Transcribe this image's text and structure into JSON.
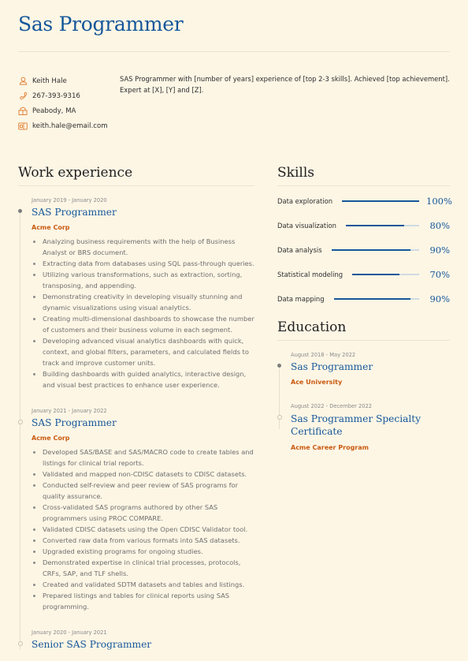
{
  "header": {
    "title": "Sas Programmer"
  },
  "contact": {
    "name": "Keith Hale",
    "phone": "267-393-9316",
    "location": "Peabody, MA",
    "email": "keith.hale@email.com",
    "icons": [
      "user-icon",
      "phone-icon",
      "location-icon",
      "email-icon"
    ],
    "icon_color": "#e0843a"
  },
  "summary": "SAS Programmer with [number of years] experience of [top 2-3 skills]. Achieved [top achievement]. Expert at [X], [Y] and [Z].",
  "work": {
    "title": "Work experience",
    "jobs": [
      {
        "date": "January 2019 - January 2020",
        "role": "SAS Programmer",
        "company": "Acme Corp",
        "bullets": [
          "Analyzing business requirements with the help of Business Analyst or BRS document.",
          "Extracting data from databases using SQL pass-through queries.",
          "Utilizing various transformations, such as extraction, sorting, transposing, and appending.",
          "Demonstrating creativity in developing visually stunning and dynamic visualizations using visual analytics.",
          "Creating multi-dimensional dashboards to showcase the number of customers and their business volume in each segment.",
          "Developing advanced visual analytics dashboards with quick, context, and global filters, parameters, and calculated fields to track and improve customer units.",
          "Building dashboards with guided analytics, interactive design, and visual best practices to enhance user experience."
        ]
      },
      {
        "date": "January 2021 - January 2022",
        "role": "SAS Programmer",
        "company": "Acme Corp",
        "bullets": [
          "Developed SAS/BASE and SAS/MACRO code to create tables and listings for clinical trial reports.",
          "Validated and mapped non-CDISC datasets to CDISC datasets.",
          "Conducted self-review and peer review of SAS programs for quality assurance.",
          "Cross-validated SAS programs authored by other SAS programmers using PROC COMPARE.",
          "Validated CDISC datasets using the Open CDISC Validator tool.",
          "Converted raw data from various formats into SAS datasets.",
          "Upgraded existing programs for ongoing studies.",
          "Demonstrated expertise in clinical trial processes, protocols, CRFs, SAP, and TLF shells.",
          "Created and validated SDTM datasets and tables and listings.",
          "Prepared listings and tables for clinical reports using SAS programming."
        ]
      },
      {
        "date": "January 2020 - January 2021",
        "role": "Senior SAS Programmer",
        "company": "",
        "bullets": []
      }
    ]
  },
  "skills": {
    "title": "Skills",
    "items": [
      {
        "name": "Data exploration",
        "value": 100,
        "label": "100%"
      },
      {
        "name": "Data visualization",
        "value": 80,
        "label": "80%"
      },
      {
        "name": "Data analysis",
        "value": 90,
        "label": "90%"
      },
      {
        "name": "Statistical modeling",
        "value": 70,
        "label": "70%"
      },
      {
        "name": "Data mapping",
        "value": 90,
        "label": "90%"
      }
    ]
  },
  "education": {
    "title": "Education",
    "items": [
      {
        "date": "August 2018 - May 2022",
        "degree": "Sas Programmer",
        "school": "Ace University"
      },
      {
        "date": "August 2022 - December 2022",
        "degree": "Sas Programmer Specialty Certificate",
        "school": "Acme Career Program"
      }
    ]
  },
  "colors": {
    "accent": "#15579a",
    "company": "#c95a10",
    "background": "#fdf6e5"
  }
}
